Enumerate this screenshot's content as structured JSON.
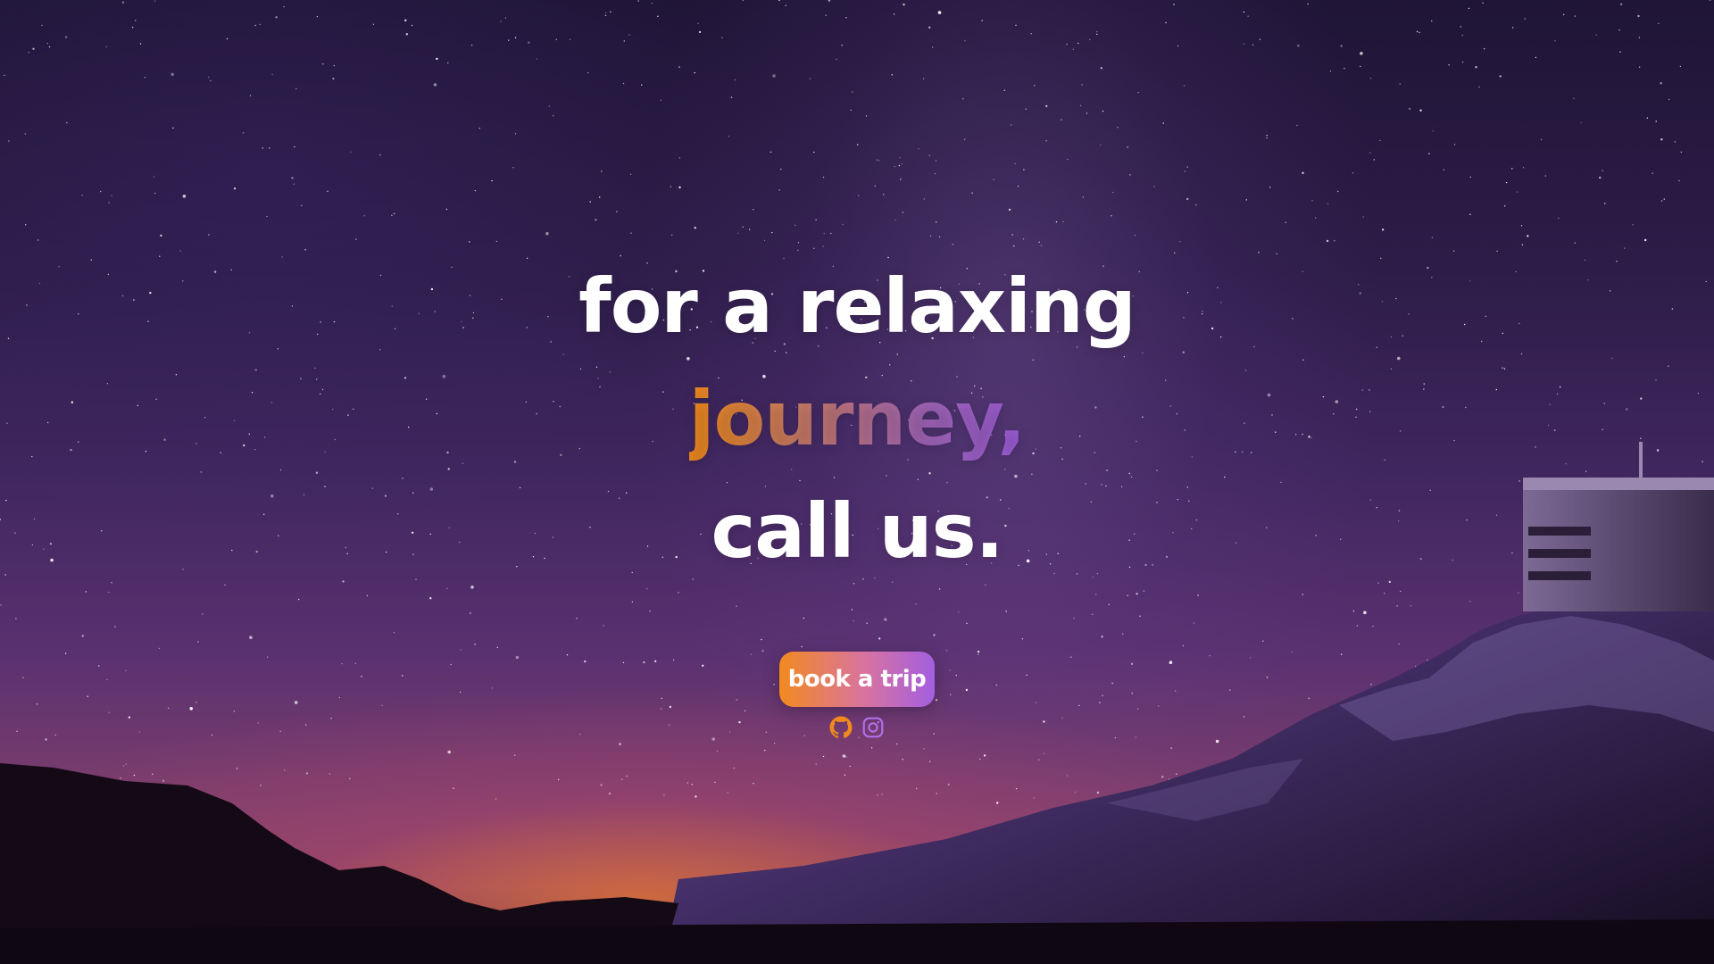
{
  "hero": {
    "line1": "for a relaxing",
    "line2": "journey,",
    "line3": "call us."
  },
  "cta": {
    "label": "book a trip"
  },
  "socials": [
    {
      "icon": "github-icon",
      "color": "#f08a1c"
    },
    {
      "icon": "instagram-icon",
      "color": "#b070e8"
    }
  ],
  "colors": {
    "accent_orange": "#f08a1c",
    "accent_purple": "#a35fe0",
    "text": "#ffffff"
  }
}
